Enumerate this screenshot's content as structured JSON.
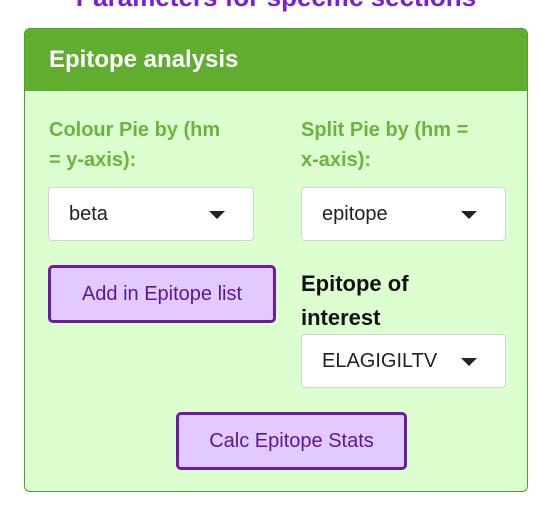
{
  "page": {
    "section_heading": "Parameters for specific sections"
  },
  "panel": {
    "title": "Epitope analysis",
    "colour_pie": {
      "label_line1": "Colour Pie by (hm",
      "label_line2": "= y-axis):",
      "value": "beta"
    },
    "split_pie": {
      "label_line1": "Split Pie by (hm =",
      "label_line2": "x-axis):",
      "value": "epitope"
    },
    "add_button_label": "Add in Epitope list",
    "epitope_of_interest": {
      "label_line1": "Epitope of",
      "label_line2": "interest",
      "value": "ELAGIGILTV"
    },
    "calc_button_label": "Calc Epitope Stats"
  },
  "colors": {
    "header_bg": "#60ad2f",
    "panel_bg": "#ddffd0",
    "label_green": "#6db33f",
    "button_bg": "#e2c9ff",
    "button_border": "#6b1aa8",
    "heading_purple": "#7a1fd1"
  },
  "icons": {
    "dropdown": "caret-down-icon"
  }
}
